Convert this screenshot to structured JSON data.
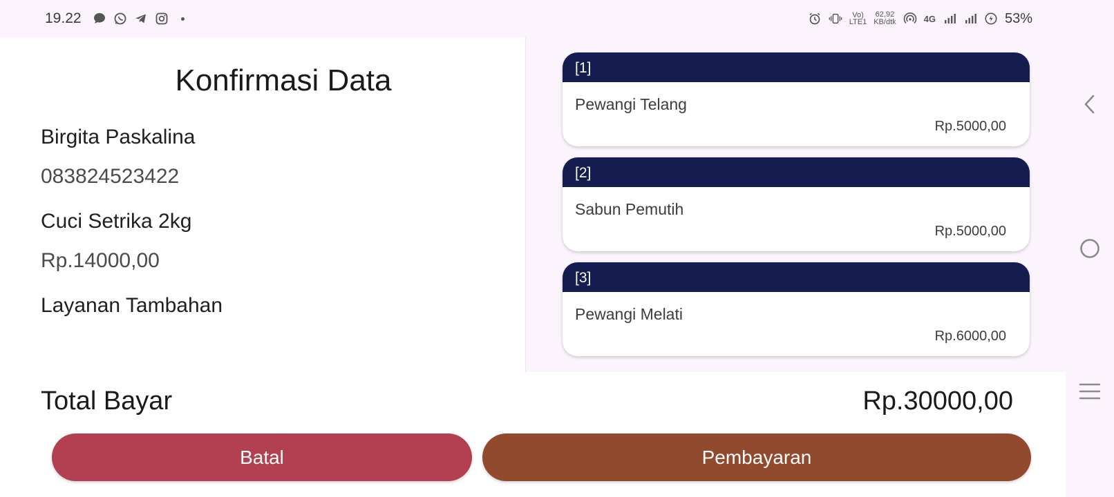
{
  "status_bar": {
    "time": "19.22",
    "network_speed_value": "62,92",
    "network_speed_unit": "KB/dtk",
    "volte_top": "Vo)",
    "volte_bottom": "LTE1",
    "network_type": "4G",
    "battery": "53%"
  },
  "page": {
    "title": "Konfirmasi Data",
    "customer_name": "Birgita Paskalina",
    "customer_phone": "083824523422",
    "service_name": "Cuci Setrika 2kg",
    "service_price": "Rp.14000,00",
    "extra_services_label": "Layanan Tambahan"
  },
  "extras": [
    {
      "index": "[1]",
      "name": "Pewangi Telang",
      "price": "Rp.5000,00"
    },
    {
      "index": "[2]",
      "name": "Sabun Pemutih",
      "price": "Rp.5000,00"
    },
    {
      "index": "[3]",
      "name": "Pewangi Melati",
      "price": "Rp.6000,00"
    }
  ],
  "total": {
    "label": "Total Bayar",
    "value": "Rp.30000,00"
  },
  "actions": {
    "cancel_label": "Batal",
    "pay_label": "Pembayaran"
  },
  "colors": {
    "card_header": "#141c50",
    "cancel_button": "#b24050",
    "pay_button": "#924a2e"
  }
}
